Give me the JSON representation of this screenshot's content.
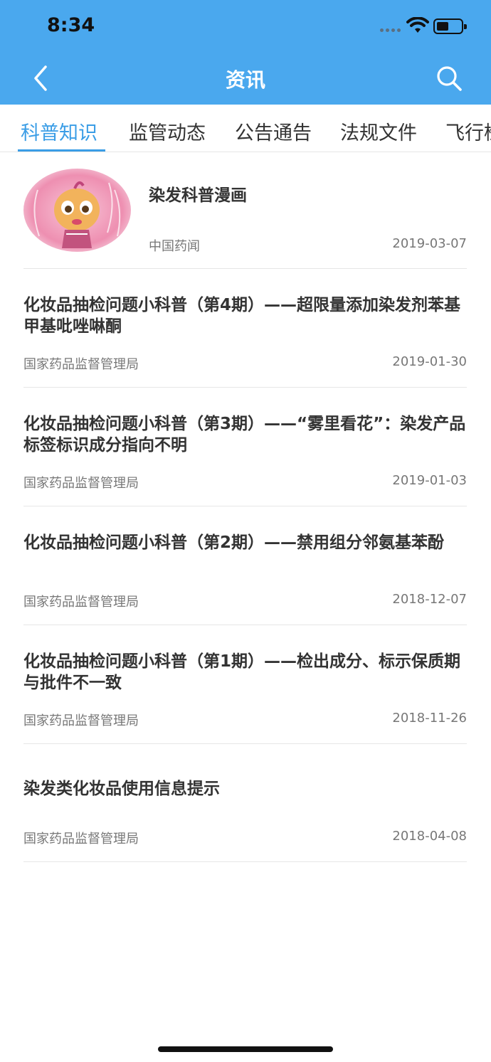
{
  "status": {
    "time": "8:34"
  },
  "nav": {
    "title": "资讯",
    "back_icon": "chevron-left-icon",
    "search_icon": "search-icon"
  },
  "tabs": [
    {
      "label": "科普知识",
      "active": true
    },
    {
      "label": "监管动态",
      "active": false
    },
    {
      "label": "公告通告",
      "active": false
    },
    {
      "label": "法规文件",
      "active": false
    },
    {
      "label": "飞行检查",
      "active": false
    }
  ],
  "colors": {
    "header": "#4aa8ee",
    "accent": "#3a9de6"
  },
  "articles": [
    {
      "title": "染发科普漫画",
      "source": "中国药闻",
      "date": "2019-03-07",
      "has_thumb": true
    },
    {
      "title": "化妆品抽检问题小科普（第4期）——超限量添加染发剂苯基甲基吡唑啉酮",
      "source": "国家药品监督管理局",
      "date": "2019-01-30"
    },
    {
      "title": "化妆品抽检问题小科普（第3期）——“雾里看花”：染发产品标签标识成分指向不明",
      "source": "国家药品监督管理局",
      "date": "2019-01-03"
    },
    {
      "title": "化妆品抽检问题小科普（第2期）——禁用组分邻氨基苯酚",
      "source": "国家药品监督管理局",
      "date": "2018-12-07"
    },
    {
      "title": "化妆品抽检问题小科普（第1期）——检出成分、标示保质期与批件不一致",
      "source": "国家药品监督管理局",
      "date": "2018-11-26"
    },
    {
      "title": "染发类化妆品使用信息提示",
      "source": "国家药品监督管理局",
      "date": "2018-04-08"
    }
  ]
}
